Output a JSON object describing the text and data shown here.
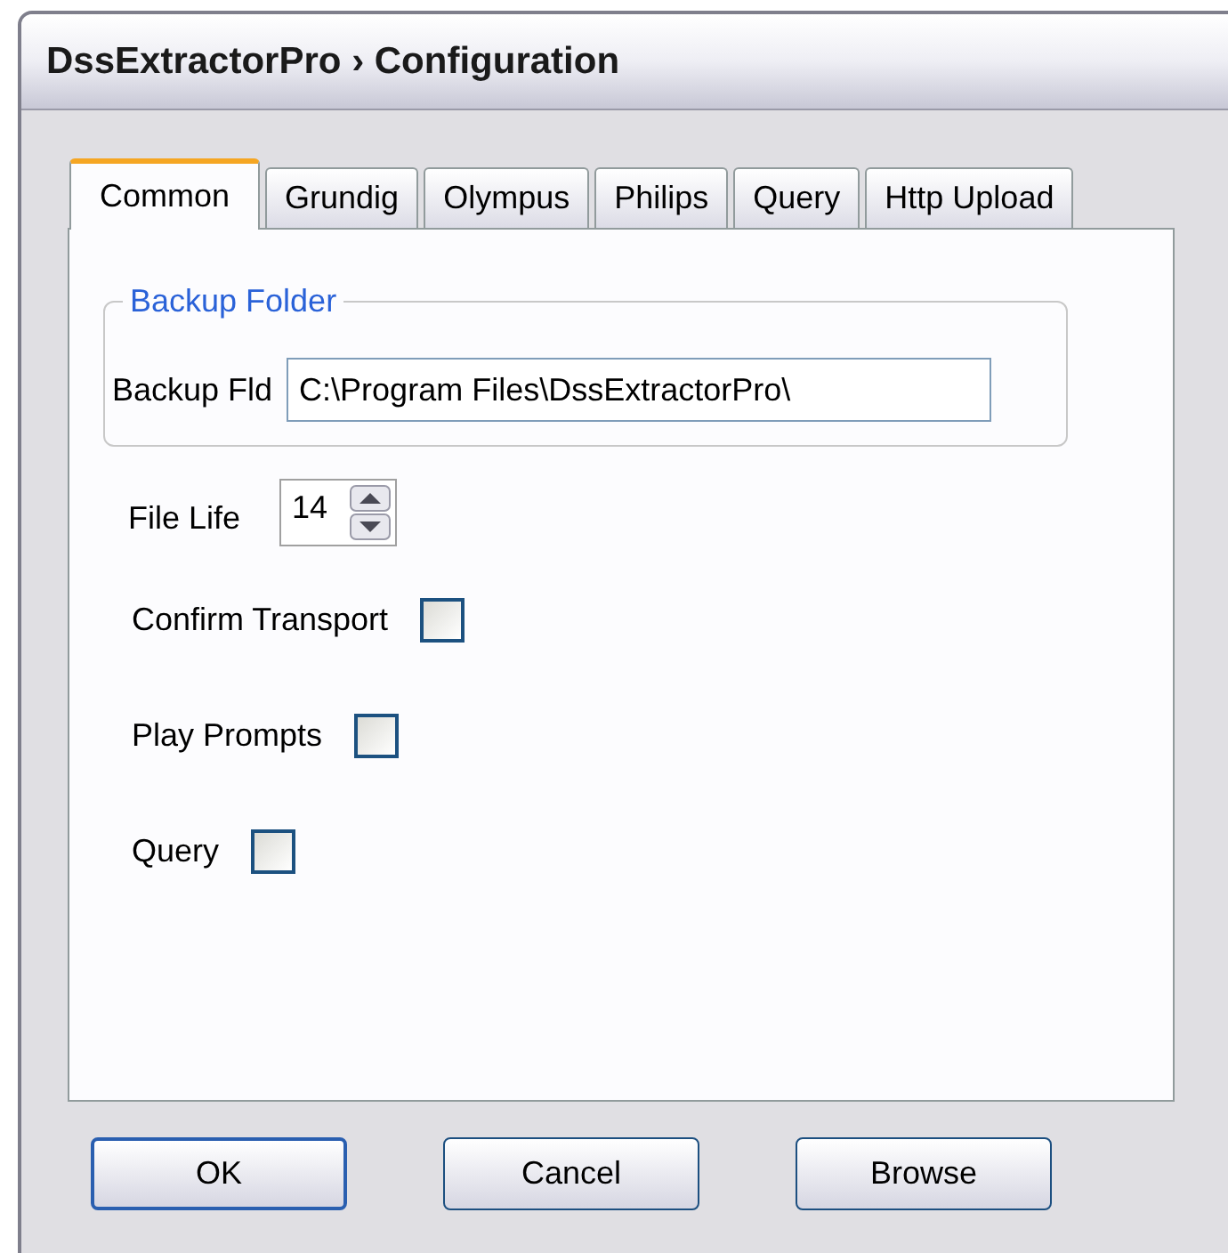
{
  "window": {
    "title": "DssExtractorPro › Configuration"
  },
  "tabs": [
    {
      "label": "Common",
      "selected": true
    },
    {
      "label": "Grundig",
      "selected": false
    },
    {
      "label": "Olympus",
      "selected": false
    },
    {
      "label": "Philips",
      "selected": false
    },
    {
      "label": "Query",
      "selected": false
    },
    {
      "label": "Http Upload",
      "selected": false
    }
  ],
  "backup_group": {
    "legend": "Backup Folder",
    "label": "Backup Fld",
    "value": "C:\\Program Files\\DssExtractorPro\\"
  },
  "file_life": {
    "label": "File Life",
    "value": "14"
  },
  "checkboxes": [
    {
      "label": "Confirm Transport",
      "checked": false
    },
    {
      "label": "Play Prompts",
      "checked": false
    },
    {
      "label": "Query",
      "checked": false
    }
  ],
  "buttons": [
    {
      "label": "OK",
      "default": true
    },
    {
      "label": "Cancel",
      "default": false
    },
    {
      "label": "Browse",
      "default": false
    }
  ]
}
